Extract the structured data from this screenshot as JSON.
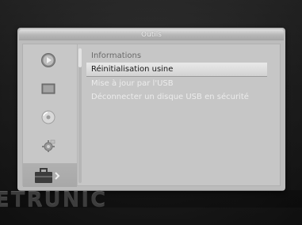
{
  "window": {
    "title": "Outils"
  },
  "sidebar": {
    "items": [
      {
        "icon": "play-icon"
      },
      {
        "icon": "screen-icon"
      },
      {
        "icon": "disc-icon"
      },
      {
        "icon": "gear-icon"
      },
      {
        "icon": "toolbox-icon",
        "active": true
      }
    ]
  },
  "menu": {
    "items": [
      {
        "label": "Informations"
      },
      {
        "label": "Réinitialisation usine",
        "selected": true
      },
      {
        "label": "Mise à jour par l'USB"
      },
      {
        "label": "Déconnecter un disque USB en sécurité"
      }
    ]
  },
  "brand": {
    "text": "ETRUNIC"
  },
  "colors": {
    "window_bg": "#bcbcbc",
    "selection_bg": "#e0e0e0",
    "title_text": "#f4f4f4"
  }
}
